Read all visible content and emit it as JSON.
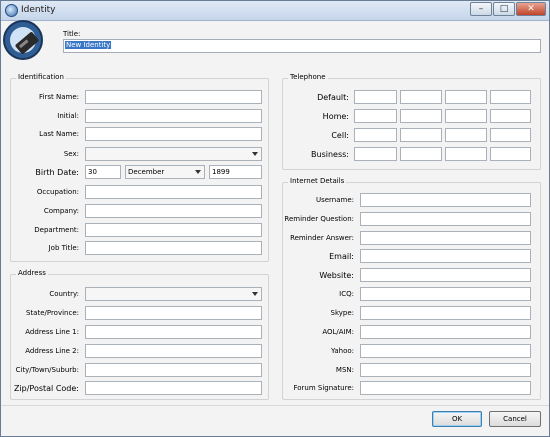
{
  "window": {
    "title": "Identity",
    "icon": "identity-app-icon"
  },
  "title_field": {
    "label": "Title:",
    "value": "New Identity"
  },
  "identification": {
    "heading": "Identification",
    "first_name": "First Name:",
    "initial": "Initial:",
    "last_name": "Last Name:",
    "sex": "Sex:",
    "birth_date": {
      "label": "Birth Date:",
      "day": "30",
      "month": "December",
      "year": "1899"
    },
    "occupation": "Occupation:",
    "company": "Company:",
    "department": "Department:",
    "job_title": "Job Title:"
  },
  "address": {
    "heading": "Address",
    "country": "Country:",
    "state": "State/Province:",
    "line1": "Address Line 1:",
    "line2": "Address Line 2:",
    "city": "City/Town/Suburb:",
    "zip": "Zip/Postal Code:"
  },
  "telephone": {
    "heading": "Telephone",
    "default": "Default:",
    "home": "Home:",
    "cell": "Cell:",
    "business": "Business:"
  },
  "internet": {
    "heading": "Internet Details",
    "username": "Username:",
    "reminder_question": "Reminder Question:",
    "reminder_answer": "Reminder Answer:",
    "email": "Email:",
    "website": "Website:",
    "icq": "ICQ:",
    "skype": "Skype:",
    "aol": "AOL/AIM:",
    "yahoo": "Yahoo:",
    "msn": "MSN:",
    "forum_signature": "Forum Signature:"
  },
  "buttons": {
    "ok": "OK",
    "cancel": "Cancel"
  }
}
